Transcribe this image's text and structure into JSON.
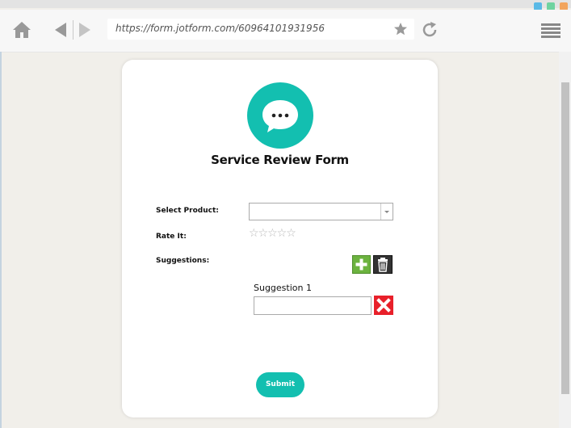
{
  "browser": {
    "url": "https://form.jotform.com/60964101931956",
    "window_dots": [
      "#5ab9e6",
      "#6fd3a0",
      "#f2a45c"
    ]
  },
  "form": {
    "title": "Service Review Form",
    "fields": {
      "product_label": "Select Product:",
      "product_value": "",
      "rate_label": "Rate It:",
      "rating": "0 of 5",
      "stars": "☆☆☆☆☆",
      "suggestions_label": "Suggestions:",
      "suggestion_1_label": "Suggestion 1",
      "suggestion_1_value": ""
    },
    "submit_label": "Submit"
  },
  "colors": {
    "accent": "#13bfb0",
    "add": "#6cb33f",
    "remove": "#e8202a"
  },
  "icons": [
    "home-icon",
    "back-icon",
    "forward-icon",
    "star-icon",
    "reload-icon",
    "menu-icon",
    "chat-bubble-icon",
    "plus-icon",
    "trash-icon",
    "close-icon",
    "chevron-down-icon"
  ]
}
